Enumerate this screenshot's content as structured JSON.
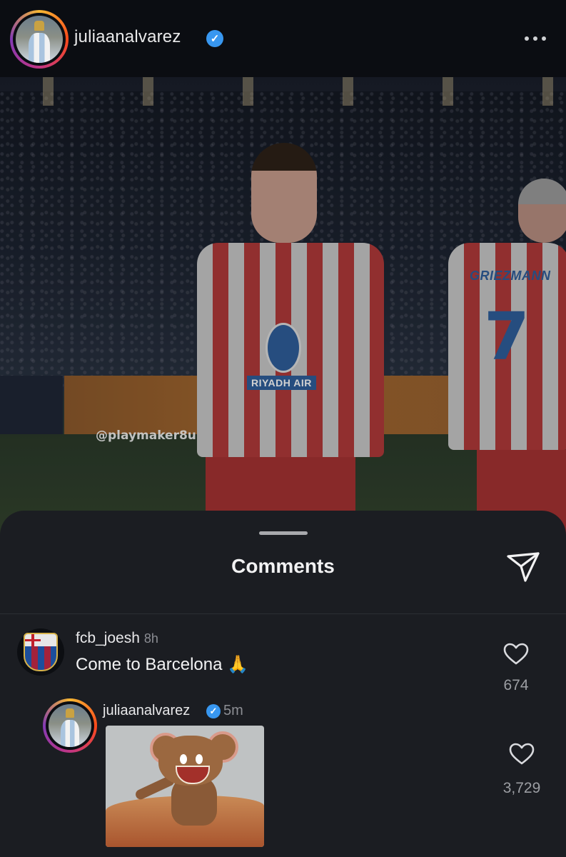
{
  "post": {
    "username": "juliaanalvarez",
    "verified_mark": "✓",
    "more_icon": "more-horizontal-icon"
  },
  "photo": {
    "watermark": "@playmaker8u",
    "sponsor_text": "RIYADH AIR",
    "back_name": "GRIEZMANN",
    "back_number": "7"
  },
  "comments_sheet": {
    "title": "Comments",
    "share_icon": "send-icon",
    "comments": [
      {
        "username": "fcb_joesh",
        "time": "8h",
        "text": "Come to Barcelona 🙏",
        "likes": "674"
      }
    ],
    "reply": {
      "username": "juliaanalvarez",
      "verified_mark": "✓",
      "time": "5m",
      "attachment": "gif",
      "likes": "3,729"
    }
  },
  "colors": {
    "background": "#0b0d12",
    "sheet": "#1b1d22",
    "verified": "#3897f0",
    "muted_text": "#8c8e94"
  }
}
